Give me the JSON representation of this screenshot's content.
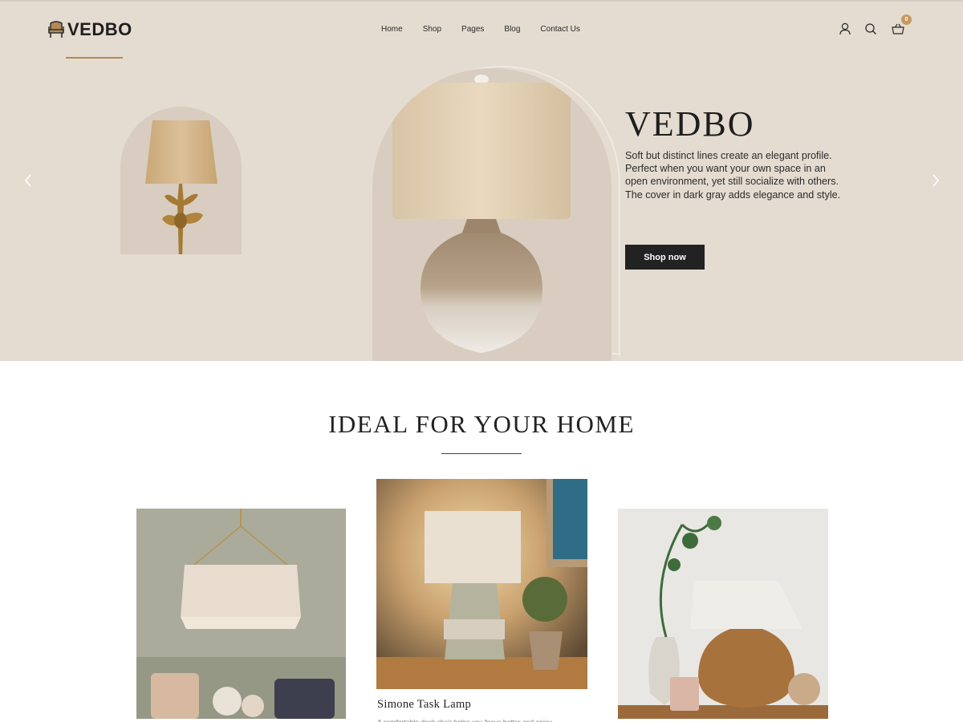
{
  "header": {
    "logo_text": "VEDBO",
    "nav": [
      "Home",
      "Shop",
      "Pages",
      "Blog",
      "Contact Us"
    ],
    "cart_count": "0",
    "icons": [
      "user-icon",
      "search-icon",
      "basket-icon"
    ]
  },
  "hero": {
    "title": "VEDBO",
    "description": "Soft but distinct lines create an elegant profile. Perfect when you want your own space in an open environment, yet still socialize with others. The cover in dark gray adds elegance and style.",
    "button_label": "Shop now"
  },
  "section": {
    "title": "IDEAL FOR YOUR HOME",
    "featured_product": {
      "name": "Simone Task Lamp",
      "description": "A comfortable desk chair helps you focus better and enjoy"
    }
  },
  "colors": {
    "hero_bg": "#e4dcd1",
    "arch_bg": "#d8cdc0",
    "button_bg": "#222222",
    "accent": "#c59a62"
  }
}
